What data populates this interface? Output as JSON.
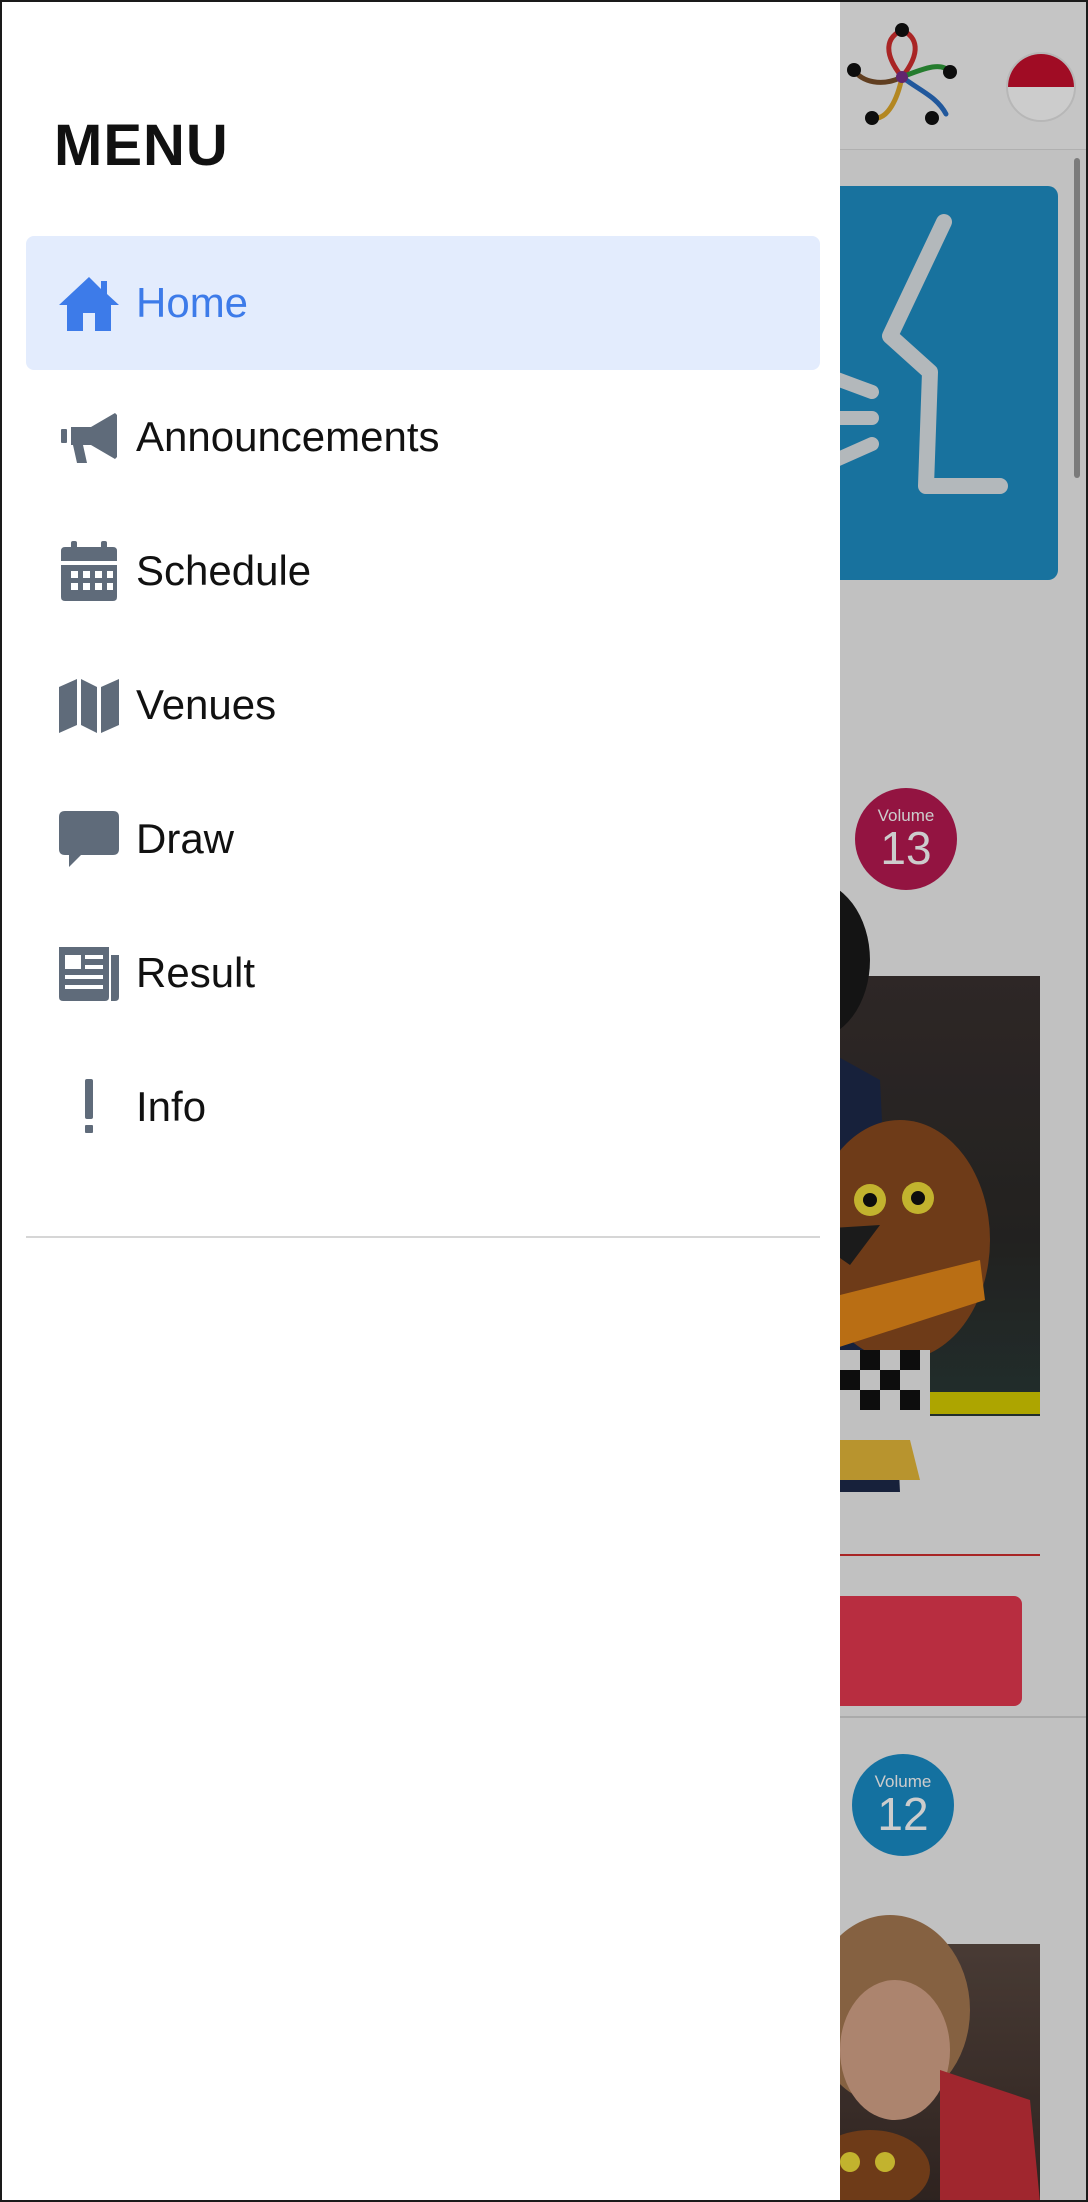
{
  "drawer": {
    "title": "MENU",
    "items": [
      {
        "label": "Home",
        "icon": "home-icon",
        "active": true
      },
      {
        "label": "Announcements",
        "icon": "megaphone-icon",
        "active": false
      },
      {
        "label": "Schedule",
        "icon": "calendar-icon",
        "active": false
      },
      {
        "label": "Venues",
        "icon": "map-icon",
        "active": false
      },
      {
        "label": "Draw",
        "icon": "speech-bubble-icon",
        "active": false
      },
      {
        "label": "Result",
        "icon": "newspaper-icon",
        "active": false
      },
      {
        "label": "Info",
        "icon": "exclamation-icon",
        "active": false
      }
    ]
  },
  "background": {
    "volumes": [
      {
        "label": "Volume",
        "number": "13"
      },
      {
        "label": "Volume",
        "number": "12"
      }
    ]
  },
  "colors": {
    "active_item_bg": "#e3ecfd",
    "active_item_text": "#3d7be9",
    "icon_gray": "#5f6b7a",
    "volume_13": "#b81a52",
    "volume_12": "#1a8ec9"
  }
}
